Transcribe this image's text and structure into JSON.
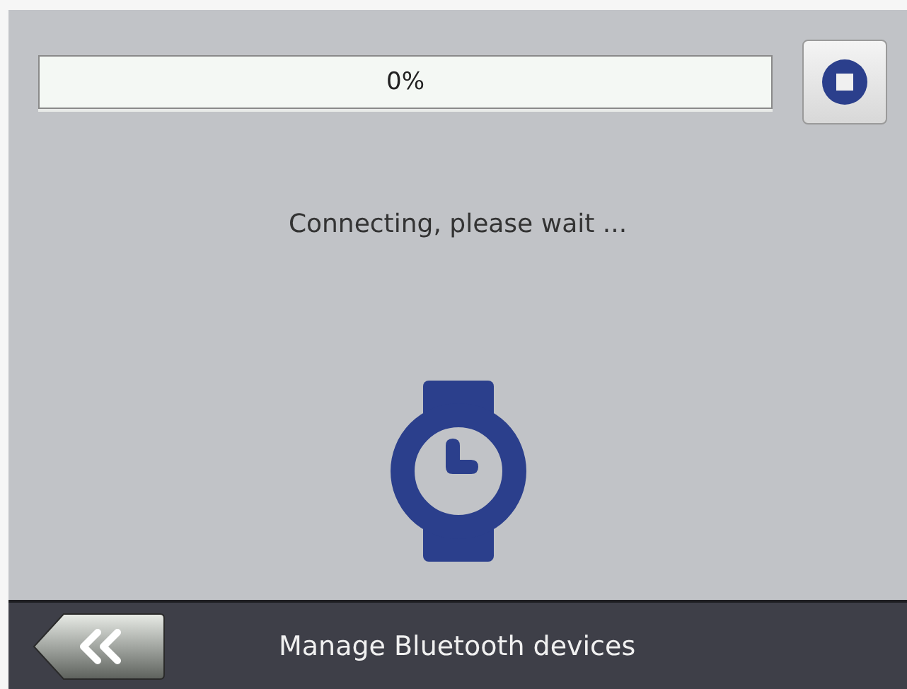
{
  "progress": {
    "level": 0,
    "label": "0%"
  },
  "message": "Connecting, please wait ...",
  "footer": {
    "title": "Manage Bluetooth devices"
  }
}
